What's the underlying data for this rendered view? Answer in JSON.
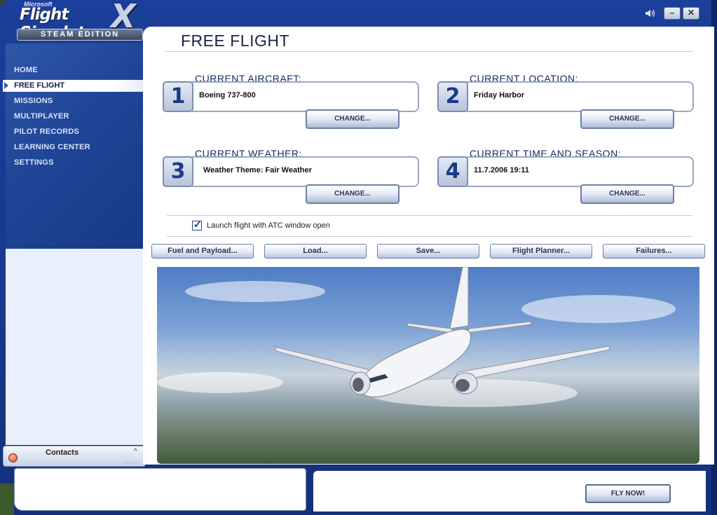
{
  "app": {
    "logo_microsoft": "Microsoft",
    "logo_name": "Flight Simulator",
    "logo_x": "X",
    "logo_edition": "STEAM EDITION"
  },
  "window_controls": {
    "sound_icon": "speaker-icon",
    "minimize": "–",
    "close": "✕"
  },
  "sidebar": {
    "items": [
      {
        "label": "HOME"
      },
      {
        "label": "FREE FLIGHT",
        "active": true
      },
      {
        "label": "MISSIONS"
      },
      {
        "label": "MULTIPLAYER"
      },
      {
        "label": "PILOT RECORDS"
      },
      {
        "label": "LEARNING CENTER"
      },
      {
        "label": "SETTINGS"
      }
    ]
  },
  "contacts": {
    "label": "Contacts",
    "chevron": "^",
    "dots": "......"
  },
  "main": {
    "title": "FREE FLIGHT",
    "sections": [
      {
        "number": "1",
        "label": "CURRENT AIRCRAFT:",
        "value": "Boeing 737-800",
        "button": "CHANGE..."
      },
      {
        "number": "2",
        "label": "CURRENT LOCATION:",
        "value": "Friday Harbor",
        "button": "CHANGE..."
      },
      {
        "number": "3",
        "label": "CURRENT WEATHER:",
        "value": "Weather Theme: Fair Weather",
        "button": "CHANGE..."
      },
      {
        "number": "4",
        "label": "CURRENT TIME AND SEASON:",
        "value": "11.7.2006 19:11",
        "button": "CHANGE..."
      }
    ],
    "atc_checkbox": {
      "label": "Launch flight with ATC window open",
      "checked": true
    },
    "actions": [
      {
        "label": "Fuel and Payload..."
      },
      {
        "label": "Load..."
      },
      {
        "label": "Save..."
      },
      {
        "label": "Flight Planner..."
      },
      {
        "label": "Failures..."
      }
    ]
  },
  "footer": {
    "fly_now": "FLY NOW!"
  }
}
